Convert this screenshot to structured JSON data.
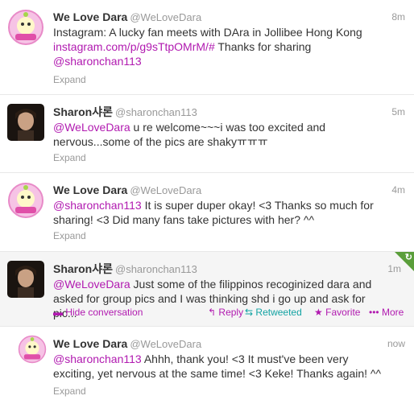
{
  "tweets": [
    {
      "fullname": "We Love Dara",
      "username": "@WeLoveDara",
      "time": "8m",
      "line1": "Instagram: A lucky fan meets with DAra in Jollibee Hong Kong",
      "link1": "instagram.com/p/g9sTtpOMrM/#",
      "line2_rest": " Thanks for sharing",
      "mention": "@sharonchan113",
      "expand": "Expand"
    },
    {
      "fullname": "Sharon샤론",
      "username": "@sharonchan113",
      "time": "5m",
      "mention": "@WeLoveDara",
      "text_rest": " u re welcome~~~i was too excited and nervous...some of the pics are shakyㅠㅠㅠ",
      "expand": "Expand"
    },
    {
      "fullname": "We Love Dara",
      "username": "@WeLoveDara",
      "time": "4m",
      "mention": "@sharonchan113",
      "text_rest": " It is super duper okay! <3 Thanks so much for sharing! <3 Did many fans take pictures with her? ^^",
      "expand": "Expand"
    },
    {
      "fullname": "Sharon샤론",
      "username": "@sharonchan113",
      "time": "1m",
      "mention": "@WeLoveDara",
      "text_rest": " Just some of the filippinos recoginized dara and asked for group pics and I was thinking shd i go up and ask for pic...",
      "actions": {
        "hide": "Hide conversation",
        "reply": "Reply",
        "retweeted": "Retweeted",
        "favorite": "Favorite",
        "more": "More"
      }
    },
    {
      "fullname": "We Love Dara",
      "username": "@WeLoveDara",
      "time": "now",
      "mention": "@sharonchan113",
      "text_rest": " Ahhh, thank you! <3 It must've been very exciting, yet nervous at the same time! <3 Keke! Thanks again! ^^",
      "expand": "Expand"
    }
  ],
  "colors": {
    "link": "#b11ab0",
    "retweet": "#13a3a3",
    "retweet_corner": "#5a9e3a"
  }
}
